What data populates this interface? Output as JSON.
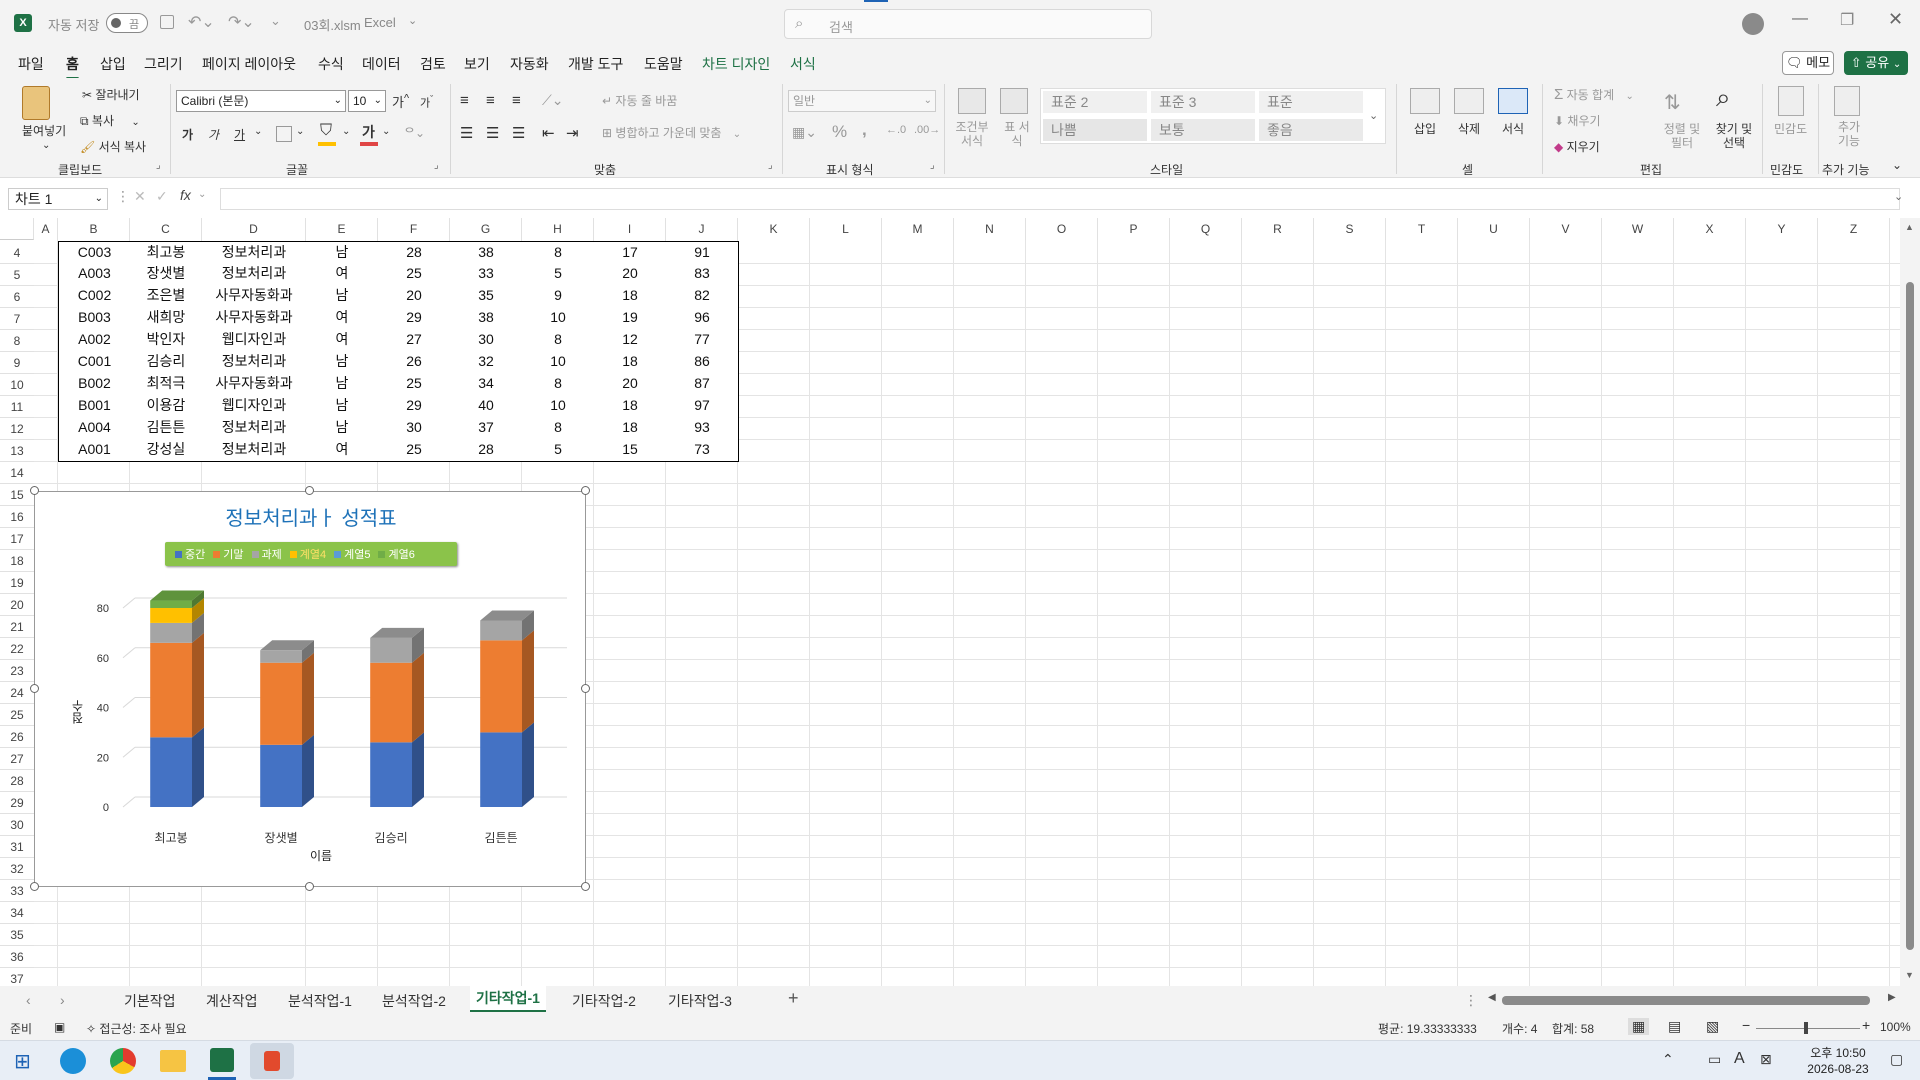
{
  "titlebar": {
    "autosave_label": "자동 저장",
    "autosave_state": "끔",
    "filename": "03회.xlsm",
    "app": "Excel",
    "search_placeholder": "검색",
    "customize_symbol": "⌄"
  },
  "menu": [
    "파일",
    "홈",
    "삽입",
    "그리기",
    "페이지 레이아웃",
    "수식",
    "데이터",
    "검토",
    "보기",
    "자동화",
    "개발 도구",
    "도움말",
    "차트 디자인",
    "서식"
  ],
  "menu_active": "홈",
  "memo_button": "메모",
  "share_button": "공유",
  "ribbon": {
    "clipboard": {
      "paste": "붙여넣기",
      "cut": "잘라내기",
      "copy": "복사",
      "format_painter": "서식 복사",
      "label": "클립보드"
    },
    "font": {
      "name": "Calibri (본문)",
      "size": "10",
      "grow": "가",
      "shrink": "가",
      "bold": "가",
      "italic": "가",
      "underline": "가",
      "fill_char": "가",
      "label": "글꼴",
      "color_accent": "#e04545"
    },
    "alignment": {
      "wrap": "자동 줄 바꿈",
      "merge": "병합하고 가운데 맞춤",
      "label": "맞춤"
    },
    "number": {
      "format": "일반",
      "percent": "%",
      "comma": ",",
      "label": "표시 형식"
    },
    "styles": {
      "conditional": "조건부 서식",
      "table": "표 서식",
      "cells": [
        "표준 2",
        "표준 3",
        "표준",
        "나쁨",
        "보통",
        "좋음"
      ],
      "label": "스타일"
    },
    "cells": {
      "insert": "삽입",
      "delete": "삭제",
      "format": "서식",
      "label": "셀"
    },
    "editing": {
      "autosum": "자동 합계",
      "fill": "채우기",
      "clear": "지우기",
      "sort": "정렬 및 필터",
      "find": "찾기 및 선택",
      "label": "편집"
    },
    "sensitivity": {
      "label": "민감도",
      "btn": "민감도"
    },
    "addins": {
      "label": "추가 기능",
      "btn": "추가 기능"
    }
  },
  "formula": {
    "namebox": "차트 1",
    "fx": "fx",
    "content": ""
  },
  "columns": [
    "A",
    "B",
    "C",
    "D",
    "E",
    "F",
    "G",
    "H",
    "I",
    "J",
    "K",
    "L",
    "M",
    "N",
    "O",
    "P",
    "Q",
    "R",
    "S",
    "T",
    "U",
    "V",
    "W",
    "X",
    "Y",
    "Z"
  ],
  "rows": [
    4,
    5,
    6,
    7,
    8,
    9,
    10,
    11,
    12,
    13,
    14,
    15,
    16,
    17,
    18,
    19,
    20,
    21,
    22,
    23,
    24,
    25,
    26,
    27,
    28,
    29,
    30,
    31,
    32,
    33,
    34,
    35,
    36,
    37
  ],
  "table": [
    [
      "C003",
      "최고봉",
      "정보처리과",
      "남",
      "28",
      "38",
      "8",
      "17",
      "91"
    ],
    [
      "A003",
      "장샛별",
      "정보처리과",
      "여",
      "25",
      "33",
      "5",
      "20",
      "83"
    ],
    [
      "C002",
      "조은별",
      "사무자동화과",
      "남",
      "20",
      "35",
      "9",
      "18",
      "82"
    ],
    [
      "B003",
      "새희망",
      "사무자동화과",
      "여",
      "29",
      "38",
      "10",
      "19",
      "96"
    ],
    [
      "A002",
      "박인자",
      "웹디자인과",
      "여",
      "27",
      "30",
      "8",
      "12",
      "77"
    ],
    [
      "C001",
      "김승리",
      "정보처리과",
      "남",
      "26",
      "32",
      "10",
      "18",
      "86"
    ],
    [
      "B002",
      "최적극",
      "사무자동화과",
      "남",
      "25",
      "34",
      "8",
      "20",
      "87"
    ],
    [
      "B001",
      "이용감",
      "웹디자인과",
      "남",
      "29",
      "40",
      "10",
      "18",
      "97"
    ],
    [
      "A004",
      "김튼튼",
      "정보처리과",
      "남",
      "30",
      "37",
      "8",
      "18",
      "93"
    ],
    [
      "A001",
      "강성실",
      "정보처리과",
      "여",
      "25",
      "28",
      "5",
      "15",
      "73"
    ]
  ],
  "chart_data": {
    "type": "bar",
    "stacked": true,
    "three_d": true,
    "title": "정보처리과ㅏ 성적표",
    "xlabel": "이름",
    "ylabel": "점수",
    "categories": [
      "최고봉",
      "장샛별",
      "김승리",
      "김튼튼"
    ],
    "ylim": [
      0,
      80
    ],
    "yticks": [
      0,
      20,
      40,
      60,
      80
    ],
    "legend_position": "top",
    "series": [
      {
        "name": "중간",
        "color": "#4472c4",
        "values": [
          28,
          25,
          26,
          30
        ]
      },
      {
        "name": "기말",
        "color": "#ed7d31",
        "values": [
          38,
          33,
          32,
          37
        ]
      },
      {
        "name": "과제",
        "color": "#a5a5a5",
        "values": [
          8,
          5,
          10,
          8
        ]
      },
      {
        "name": "계열4",
        "color": "#ffc000",
        "values": [
          6,
          0,
          0,
          0
        ]
      },
      {
        "name": "계열5",
        "color": "#5b9bd5",
        "values": [
          0,
          0,
          0,
          0
        ]
      },
      {
        "name": "계열6",
        "color": "#70ad47",
        "values": [
          3,
          0,
          0,
          0
        ]
      }
    ]
  },
  "sheet_tabs": [
    "기본작업",
    "계산작업",
    "분석작업-1",
    "분석작업-2",
    "기타작업-1",
    "기타작업-2",
    "기타작업-3"
  ],
  "sheet_active": "기타작업-1",
  "status": {
    "ready": "준비",
    "accessibility": "접근성: 조사 필요",
    "average": "평균: 19.33333333",
    "count": "개수: 4",
    "sum": "합계: 58",
    "zoom": "100%"
  },
  "taskbar": {
    "time": "오후 10:50",
    "date": "2026-08-23",
    "ime": "A"
  }
}
